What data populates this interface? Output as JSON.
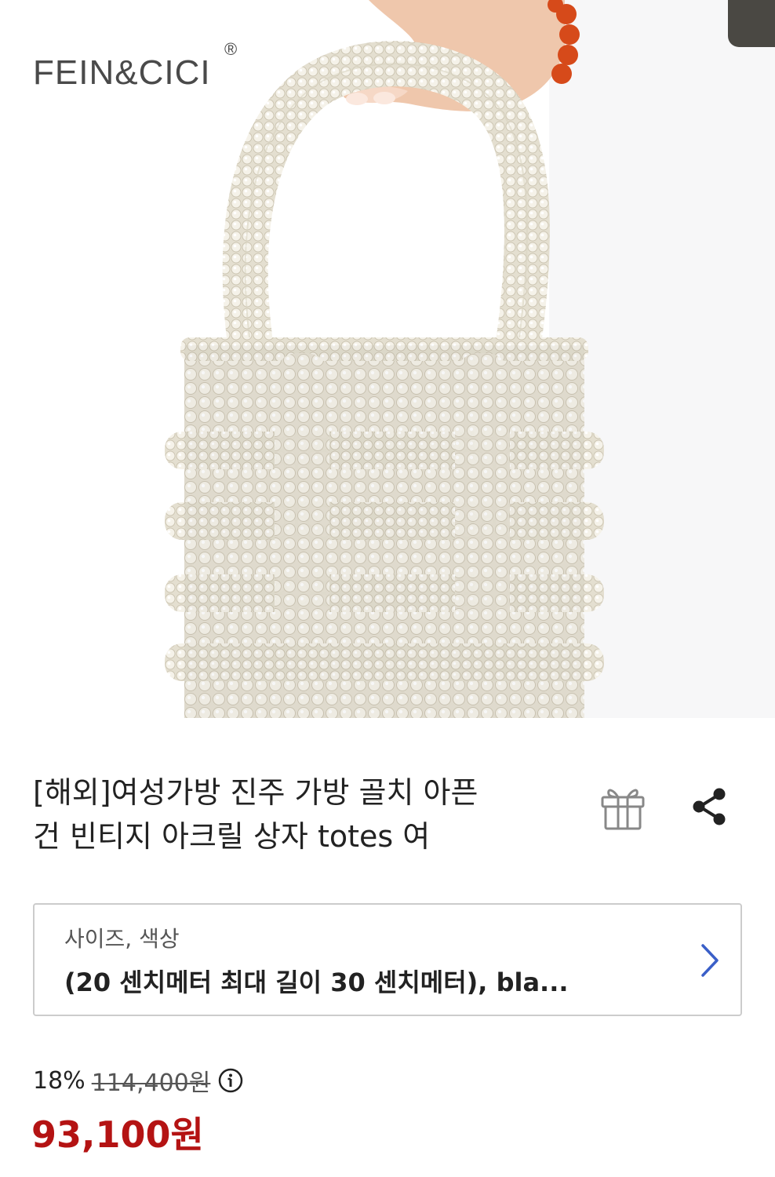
{
  "product_image": {
    "brand": "FEIN&CICI",
    "brand_mark": "®"
  },
  "product": {
    "title_line1": "[해외]여성가방 진주 가방 골치 아픈",
    "title_line2": "건 빈티지 아크릴 상자 totes 여"
  },
  "actions": {
    "gift_icon": "gift-icon",
    "share_icon": "share-icon"
  },
  "option": {
    "label": "사이즈, 색상",
    "value": "(20 센치메터 최대 길이 30 센치메터), bla..."
  },
  "price": {
    "discount_rate": "18%",
    "original": "114,400원",
    "final": "93,100원",
    "info_icon": "info-icon"
  },
  "colors": {
    "final_price": "#b41313",
    "text": "#222222",
    "border": "#cccccc",
    "chevron": "#3a5fc8"
  }
}
